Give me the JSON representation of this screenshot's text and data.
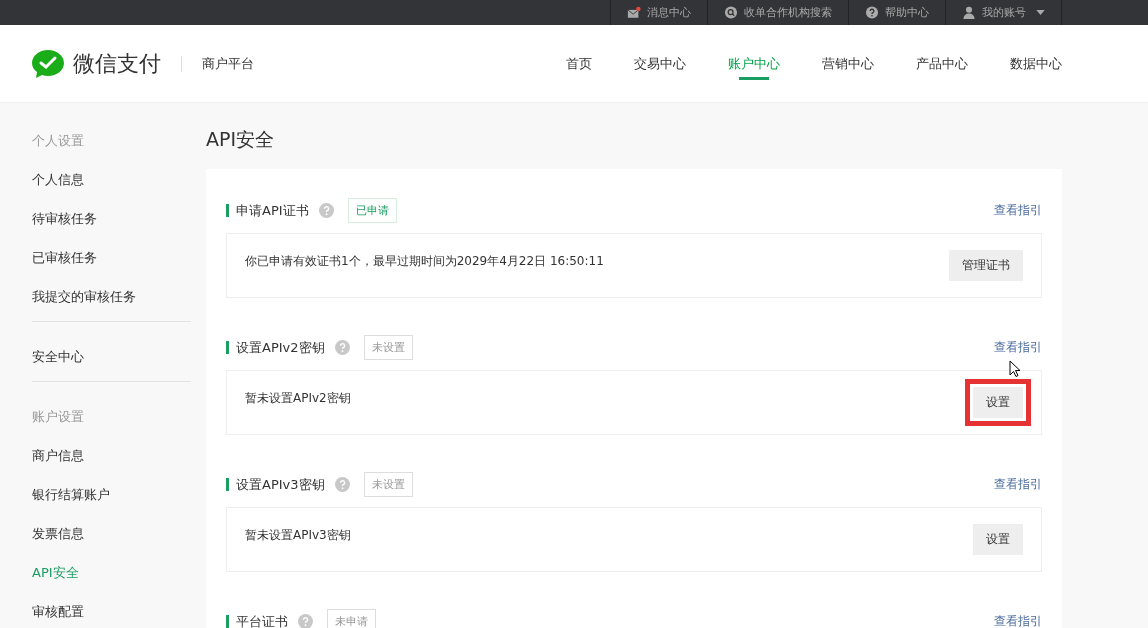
{
  "top_bar": {
    "links": [
      {
        "kind": "mail",
        "label": "消息中心",
        "has_alert": true
      },
      {
        "kind": "search",
        "label": "收单合作机构搜索"
      },
      {
        "kind": "help",
        "label": "帮助中心"
      },
      {
        "kind": "user",
        "label": "我的账号",
        "dropdown": true
      }
    ]
  },
  "header": {
    "logo": "微信支付",
    "subtitle": "商户平台",
    "nav": [
      {
        "label": "首页",
        "selected": false
      },
      {
        "label": "交易中心",
        "selected": false
      },
      {
        "label": "账户中心",
        "selected": true
      },
      {
        "label": "营销中心",
        "selected": false
      },
      {
        "label": "产品中心",
        "selected": false
      },
      {
        "label": "数据中心",
        "selected": false
      }
    ]
  },
  "sidebar": {
    "groups": [
      {
        "heading": "个人设置",
        "items": [
          {
            "label": "个人信息",
            "selected": false
          },
          {
            "label": "待审核任务",
            "selected": false
          },
          {
            "label": "已审核任务",
            "selected": false
          },
          {
            "label": "我提交的审核任务",
            "selected": false
          }
        ]
      },
      {
        "items": [
          {
            "label": "安全中心",
            "selected": false
          }
        ]
      },
      {
        "heading": "账户设置",
        "items": [
          {
            "label": "商户信息",
            "selected": false
          },
          {
            "label": "银行结算账户",
            "selected": false
          },
          {
            "label": "发票信息",
            "selected": false
          },
          {
            "label": "API安全",
            "selected": true
          },
          {
            "label": "审核配置",
            "selected": false
          }
        ]
      }
    ]
  },
  "page_title": "API安全",
  "sections": [
    {
      "title": "申请API证书",
      "status": {
        "kind": "done",
        "label": "已申请"
      },
      "guide_link": "查看指引",
      "body": "你已申请有效证书1个，最早过期时间为2029年4月22日 16:50:11",
      "button": "管理证书",
      "highlighted": false
    },
    {
      "title": "设置APIv2密钥",
      "status": {
        "kind": "pending",
        "label": "未设置"
      },
      "guide_link": "查看指引",
      "body": "暂未设置APIv2密钥",
      "button": "设置",
      "highlighted": true
    },
    {
      "title": "设置APIv3密钥",
      "status": {
        "kind": "pending",
        "label": "未设置"
      },
      "guide_link": "查看指引",
      "body": "暂未设置APIv3密钥",
      "button": "设置",
      "highlighted": false
    },
    {
      "title": "平台证书",
      "status": {
        "kind": "pending",
        "label": "未申请"
      },
      "guide_link": "查看指引"
    }
  ]
}
